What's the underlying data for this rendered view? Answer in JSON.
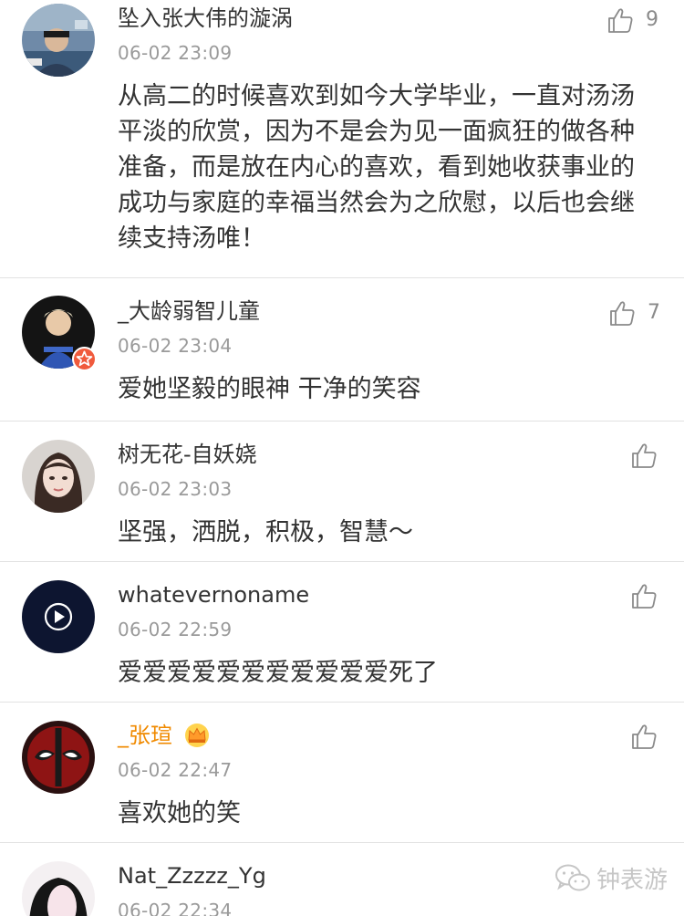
{
  "comments": [
    {
      "username": "坠入张大伟的漩涡",
      "time": "06-02 23:09",
      "content": "从高二的时候喜欢到如今大学毕业，一直对汤汤平淡的欣赏，因为不是会为见一面疯狂的做各种准备，而是放在内心的喜欢，看到她收获事业的成功与家庭的幸福当然会为之欣慰，以后也会继续支持汤唯！",
      "likes": "9"
    },
    {
      "username": "_大龄弱智儿童",
      "time": "06-02 23:04",
      "content": "爱她坚毅的眼神 干净的笑容",
      "likes": "7"
    },
    {
      "username": "树无花-自妖娆",
      "time": "06-02 23:03",
      "content": "坚强，洒脱，积极，智慧～",
      "likes": ""
    },
    {
      "username": "whatevernoname",
      "time": "06-02 22:59",
      "content": "爱爱爱爱爱爱爱爱爱爱爱死了",
      "likes": ""
    },
    {
      "username": "_张瑄",
      "time": "06-02 22:47",
      "content": "喜欢她的笑",
      "likes": ""
    },
    {
      "username": "Nat_Zzzzz_Yg",
      "time": "06-02 22:34",
      "content": "",
      "likes": ""
    }
  ],
  "watermark": {
    "text": "钟表游"
  },
  "icons": {
    "like": "thumbs-up-icon",
    "badge": "star-badge-icon",
    "crown": "crown-icon",
    "watermark": "wechat-icon"
  },
  "colors": {
    "vip_username": "#f08a00",
    "timestamp": "#9a9a9a",
    "divider": "#e2e2e2",
    "badge": "#f05a3c"
  }
}
